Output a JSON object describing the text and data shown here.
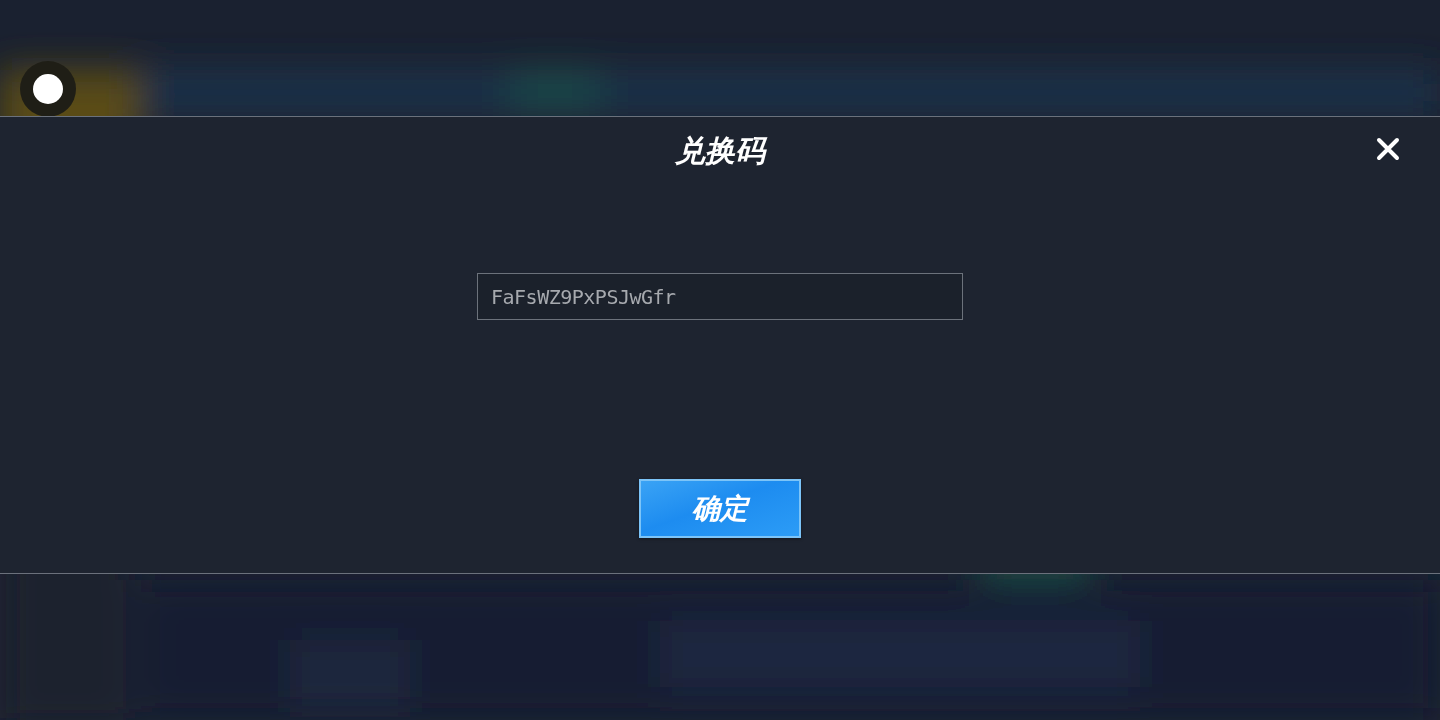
{
  "dialog": {
    "title": "兑换码",
    "code_field": {
      "value": "FaFsWZ9PxPSJwGfr"
    },
    "confirm_button": "确定"
  }
}
